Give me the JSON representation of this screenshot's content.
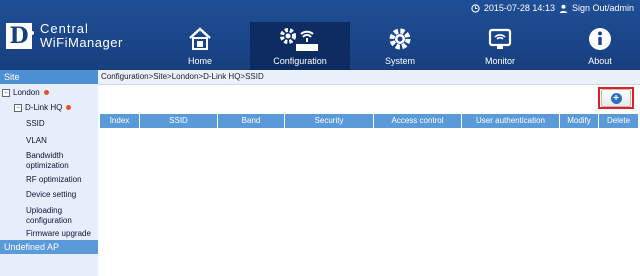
{
  "topbar": {
    "datetime": "2015-07-28 14:13",
    "signout": "Sign Out/admin"
  },
  "logo": {
    "letter": "D",
    "line1": "Central",
    "line2": "WiFiManager"
  },
  "nav": [
    {
      "label": "Home",
      "icon": "home-icon"
    },
    {
      "label": "Configuration",
      "icon": "configuration-icon"
    },
    {
      "label": "System",
      "icon": "gear-icon"
    },
    {
      "label": "Monitor",
      "icon": "monitor-icon"
    },
    {
      "label": "About",
      "icon": "info-icon"
    }
  ],
  "sidebar": {
    "header": "Site",
    "site": "London",
    "group": "D-Link HQ",
    "items": [
      "SSID",
      "VLAN",
      "Bandwidth optimization",
      "RF optimization",
      "Device setting",
      "Uploading configuration",
      "Firmware upgrade"
    ],
    "undefined": "Undefined AP"
  },
  "breadcrumb": "Configuration>Site>London>D-Link HQ>SSID",
  "table": {
    "columns": [
      "Index",
      "SSID",
      "Band",
      "Security",
      "Access control",
      "User authentication",
      "Modify",
      "Delete"
    ]
  },
  "colors": {
    "header": "#1f4f96",
    "active_nav": "#0c2c62",
    "accent": "#5b9ad8",
    "highlight": "#e02020"
  }
}
